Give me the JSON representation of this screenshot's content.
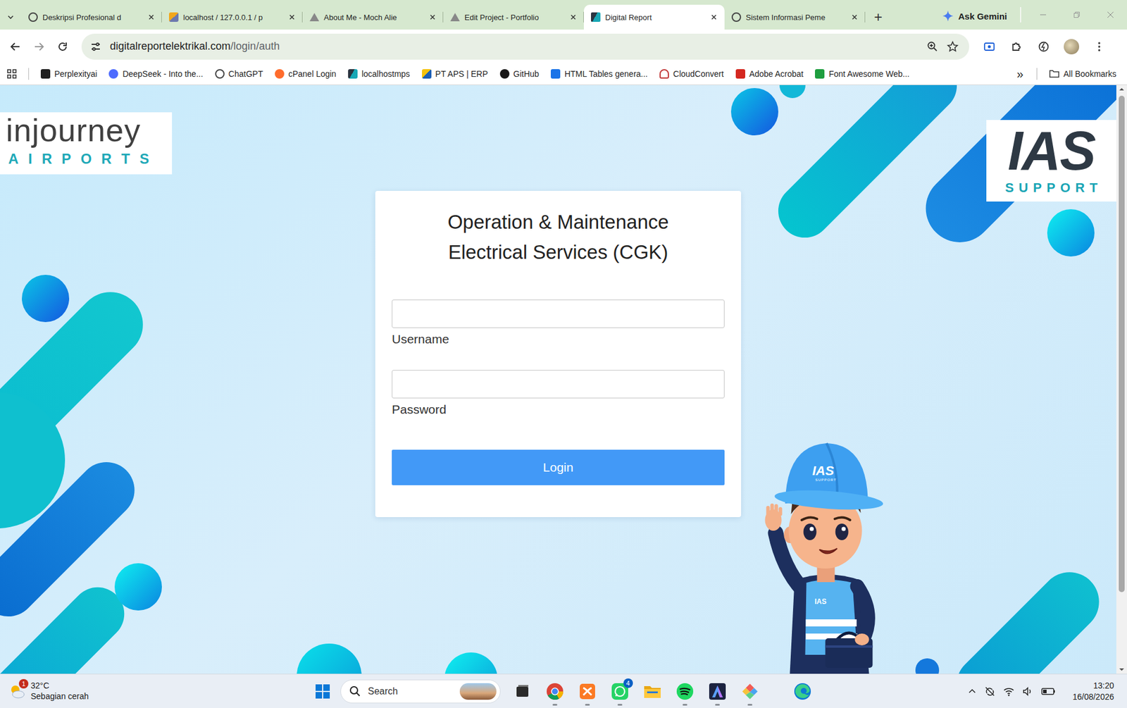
{
  "tabs": [
    {
      "label": "Deskripsi Profesional d",
      "kind": "chatgpt",
      "selected": false
    },
    {
      "label": "localhost / 127.0.0.1 / p",
      "kind": "phpmyadmin",
      "selected": false
    },
    {
      "label": "About Me - Moch Alie",
      "kind": "portfolio",
      "selected": false
    },
    {
      "label": "Edit Project - Portfolio",
      "kind": "portfolio",
      "selected": false
    },
    {
      "label": "Digital Report",
      "kind": "ias",
      "selected": true
    },
    {
      "label": "Sistem Informasi Peme",
      "kind": "chatgpt",
      "selected": false
    }
  ],
  "new_tab": "+",
  "gemini": {
    "label": "Ask Gemini"
  },
  "address_bar": {
    "host": "digitalreportelektrikal.com",
    "path": "/login/auth"
  },
  "bookmarks": [
    {
      "label": "Perplexityai",
      "kind": "perplexity"
    },
    {
      "label": "DeepSeek - Into the...",
      "kind": "deepseek"
    },
    {
      "label": "ChatGPT",
      "kind": "chatgpt"
    },
    {
      "label": "cPanel Login",
      "kind": "cpanel"
    },
    {
      "label": "localhostmps",
      "kind": "ias"
    },
    {
      "label": "PT APS | ERP",
      "kind": "aps"
    },
    {
      "label": "GitHub",
      "kind": "github"
    },
    {
      "label": "HTML Tables genera...",
      "kind": "tables"
    },
    {
      "label": "CloudConvert",
      "kind": "cloud"
    },
    {
      "label": "Adobe Acrobat",
      "kind": "acrobat"
    },
    {
      "label": "Font Awesome Web...",
      "kind": "fontawesome"
    }
  ],
  "bookmarks_overflow": "»",
  "all_bookmarks": "All Bookmarks",
  "page": {
    "left_logo": {
      "word": "injourney",
      "sub": "AIRPORTS"
    },
    "right_logo": {
      "mark": "IAS",
      "sub": "SUPPORT"
    },
    "form": {
      "title_lines": [
        "Operation & Maintenance",
        "Electrical Services (CGK)"
      ],
      "fields": [
        {
          "label": "Username",
          "value": "",
          "kind": "text"
        },
        {
          "label": "Password",
          "value": "",
          "kind": "password"
        }
      ],
      "submit": "Login"
    },
    "mascot": {
      "cap_mark": "IAS",
      "cap_sub": "SUPPORT",
      "vest_mark": "IAS"
    }
  },
  "taskbar": {
    "weather": {
      "temp": "32°C",
      "desc": "Sebagian cerah",
      "badge": "1"
    },
    "search": {
      "placeholder": "Search"
    },
    "apps": [
      {
        "kind": "taskview",
        "running": false,
        "badge": ""
      },
      {
        "kind": "chrome",
        "running": true,
        "badge": ""
      },
      {
        "kind": "xampp",
        "running": true,
        "badge": ""
      },
      {
        "kind": "whatsapp",
        "running": true,
        "badge": "4"
      },
      {
        "kind": "explorer",
        "running": false,
        "badge": ""
      },
      {
        "kind": "spotify",
        "running": true,
        "badge": ""
      },
      {
        "kind": "arc",
        "running": true,
        "badge": ""
      },
      {
        "kind": "diamond",
        "running": true,
        "badge": ""
      },
      {
        "kind": "edge",
        "running": false,
        "badge": ""
      }
    ],
    "clock": {
      "time": "13:20",
      "date": "16/08/2026"
    }
  }
}
